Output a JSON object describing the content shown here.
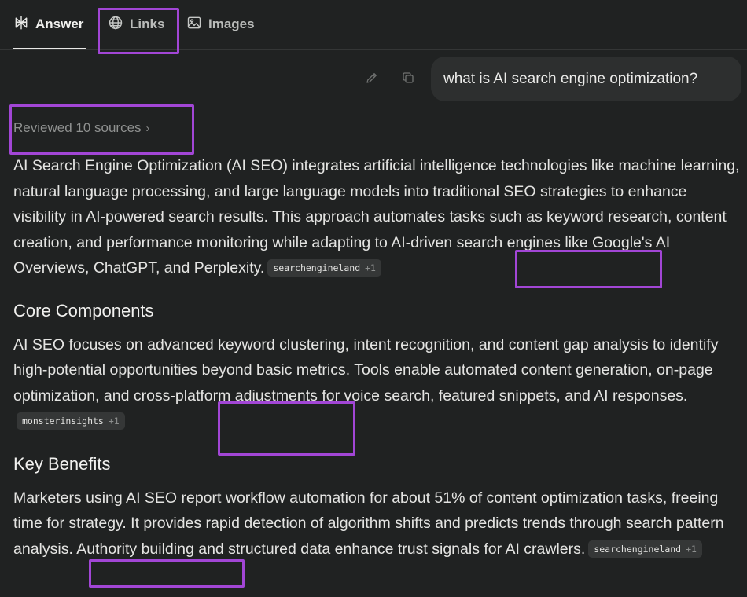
{
  "tabs": [
    {
      "label": "Answer",
      "icon": "perplexity-logo-icon"
    },
    {
      "label": "Links",
      "icon": "globe-icon"
    },
    {
      "label": "Images",
      "icon": "image-icon"
    }
  ],
  "query": {
    "text": "what is AI search engine optimization?",
    "actions": [
      "edit-pencil-icon",
      "copy-icon"
    ]
  },
  "reviewed": {
    "label": "Reviewed 10 sources",
    "chevron": "›"
  },
  "answer": {
    "intro": "AI Search Engine Optimization (AI SEO) integrates artificial intelligence technologies like machine learning, natural language processing, and large language models into traditional SEO strategies to enhance visibility in AI-powered search results. This approach automates tasks such as keyword research, content creation, and performance monitoring while adapting to AI-driven search engines like Google's AI Overviews, ChatGPT, and Perplexity.",
    "intro_cite": {
      "source": "searchengineland",
      "more": "+1"
    },
    "sections": [
      {
        "heading": "Core Components",
        "body": "AI SEO focuses on advanced keyword clustering, intent recognition, and content gap analysis to identify high-potential opportunities beyond basic metrics. Tools enable automated content generation, on-page optimization, and cross-platform adjustments for voice search, featured snippets, and AI responses.",
        "cite": {
          "source": "monsterinsights",
          "more": "+1"
        }
      },
      {
        "heading": "Key Benefits",
        "body": "Marketers using AI SEO report workflow automation for about 51% of content optimization tasks, freeing time for strategy. It provides rapid detection of algorithm shifts and predicts trends through search pattern analysis. Authority building and structured data enhance trust signals for AI crawlers.",
        "cite": {
          "source": "searchengineland",
          "more": "+1"
        }
      }
    ]
  },
  "colors": {
    "background": "#202222",
    "highlight": "#a246d6",
    "bubble": "#2d2f2f",
    "citation_bg": "#353737"
  }
}
